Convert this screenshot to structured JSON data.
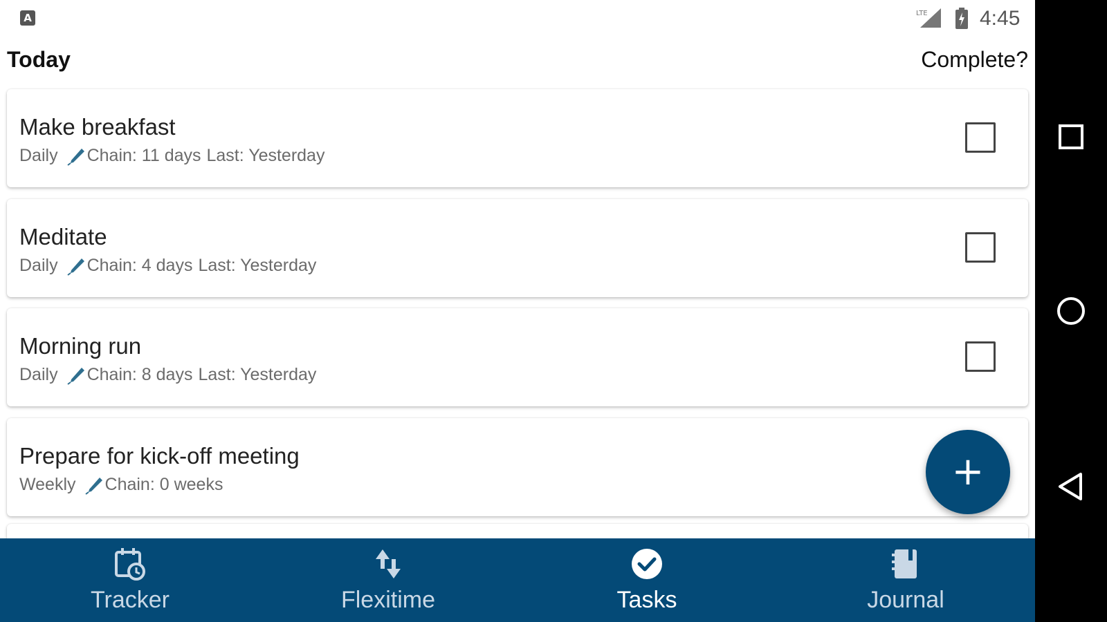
{
  "status_bar": {
    "notification_icon": "A",
    "network_badge": "LTE",
    "time": "4:45"
  },
  "header": {
    "title": "Today",
    "complete_label": "Complete?"
  },
  "tasks": [
    {
      "title": "Make breakfast",
      "frequency": "Daily",
      "chain": "Chain: 11 days",
      "last": "Last: Yesterday",
      "completed": false
    },
    {
      "title": "Meditate",
      "frequency": "Daily",
      "chain": "Chain: 4 days",
      "last": "Last: Yesterday",
      "completed": false
    },
    {
      "title": "Morning run",
      "frequency": "Daily",
      "chain": "Chain: 8 days",
      "last": "Last: Yesterday",
      "completed": false
    },
    {
      "title": "Prepare for kick-off meeting",
      "frequency": "Weekly",
      "chain": "Chain: 0 weeks",
      "last": ""
    }
  ],
  "fab": {
    "label": "+"
  },
  "bottom_nav": {
    "items": [
      {
        "label": "Tracker",
        "icon": "calendar-clock-icon"
      },
      {
        "label": "Flexitime",
        "icon": "swap-vertical-icon"
      },
      {
        "label": "Tasks",
        "icon": "check-circle-icon",
        "active": true
      },
      {
        "label": "Journal",
        "icon": "notebook-icon"
      }
    ]
  },
  "colors": {
    "primary": "#044a77",
    "meta_text": "#6b6b6b",
    "chain_icon": "#2f6f8f"
  }
}
